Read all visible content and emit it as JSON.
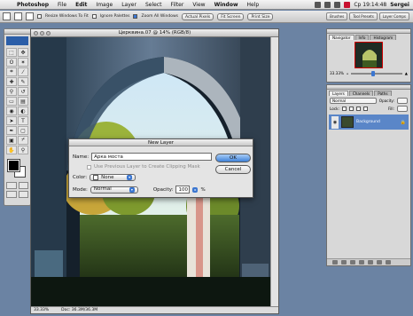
{
  "menubar": {
    "items": [
      "Photoshop",
      "File",
      "Edit",
      "Image",
      "Layer",
      "Select",
      "Filter",
      "View",
      "Window",
      "Help"
    ],
    "clock": "Ср 19:14:48",
    "user": "Sergei"
  },
  "optionsbar": {
    "resize_windows": "Resize Windows To Fit",
    "ignore_palettes": "Ignore Palettes",
    "zoom_all": "Zoom All Windows",
    "actual_pixels": "Actual Pixels",
    "fit_screen": "Fit Screen",
    "print_size": "Print Size",
    "palette_well": [
      "Brushes",
      "Tool Presets",
      "Layer Comps"
    ]
  },
  "document": {
    "title": "Церквина.07 @ 14% (RGB/8)",
    "zoom": "33.33%",
    "doc_size": "Doc: 36.3M/36.3M"
  },
  "dialog": {
    "title": "New Layer",
    "name_label": "Name:",
    "name_value": "Арка моста",
    "clipping_label": "Use Previous Layer to Create Clipping Mask",
    "color_label": "Color:",
    "color_value": "None",
    "mode_label": "Mode:",
    "mode_value": "Normal",
    "opacity_label": "Opacity:",
    "opacity_value": "100",
    "percent": "%",
    "ok_label": "OK",
    "cancel_label": "Cancel"
  },
  "navigator": {
    "tabs": [
      "Navigator",
      "Info",
      "Histogram"
    ],
    "zoom": "33.33%"
  },
  "layers": {
    "tabs": [
      "Layers",
      "Channels",
      "Paths"
    ],
    "blend": "Normal",
    "opacity_label": "Opacity:",
    "lock_label": "Lock:",
    "fill_label": "Fill:",
    "layer_name": "Background"
  }
}
